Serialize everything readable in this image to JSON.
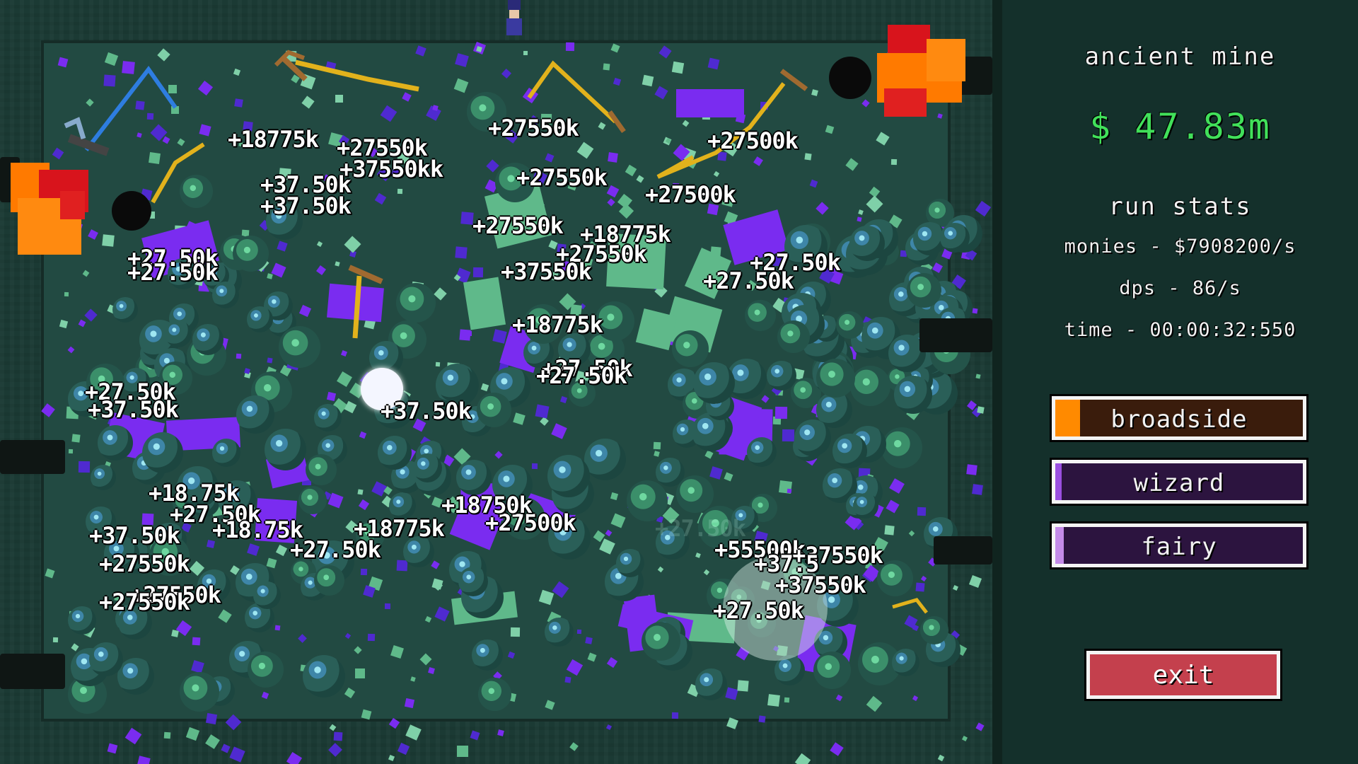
{
  "hud": {
    "mine_name": "ancient mine",
    "money": "$ 47.83m",
    "run_stats_title": "run stats",
    "monies": "monies - $7908200/s",
    "dps": "dps - 86/s",
    "time": "time - 00:00:32:550"
  },
  "abilities": [
    {
      "label": "broadside",
      "color": "#ff8a00",
      "charge": 0.1
    },
    {
      "label": "wizard",
      "color": "#9a4fe0",
      "charge": 0.02
    },
    {
      "label": "fairy",
      "color": "#c48be8",
      "charge": 0.035
    }
  ],
  "exit_label": "exit",
  "colors": {
    "money": "#41e05a",
    "exit": "#c4404d",
    "particle_purple": "#7a2cf0",
    "particle_green": "#5fb98a",
    "blast_orange": "#ff7a00",
    "blast_red": "#d8141c",
    "pickaxe_gold": "#e2b21c",
    "pickaxe_blue": "#2e7de0"
  },
  "icons": [
    "pickaxe-icon",
    "cannon-icon",
    "explosion-icon",
    "wizard-sprite-icon",
    "ore-rock-icon"
  ],
  "floating_texts": [
    "+18775k",
    "+27550k",
    "+37550kk",
    "+37.50k",
    "+37.50k",
    "+27.50k",
    "+27.50k",
    "+27550k",
    "+27500k",
    "+27550k",
    "+27500k",
    "+27550k",
    "+18775k",
    "+27550k",
    "+37550k",
    "+27.50k",
    "+27.50k",
    "+18775k",
    "+27.50k",
    "+37.50k",
    "+27.50k",
    "+27.50k",
    "+37.50k",
    "+18.75k",
    "+27.50k",
    "+37.50k",
    "+18.75k",
    "+27.50k",
    "+27550k",
    "+55500k",
    "+37550k",
    "+37.5",
    "+27500k",
    "+18750k",
    "+27550k",
    "+27550k",
    "+18775k",
    "+27.50k",
    "+37550k",
    "+27.50k"
  ]
}
